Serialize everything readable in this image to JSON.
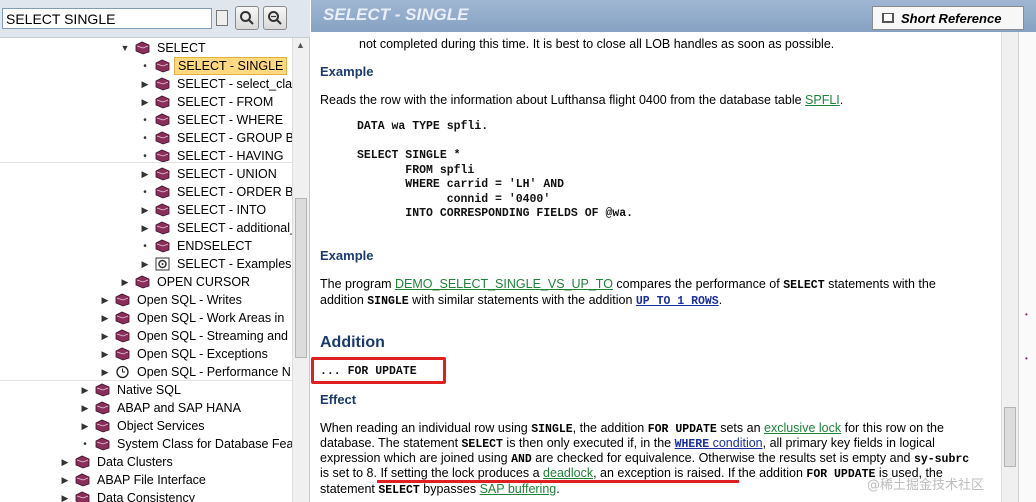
{
  "search": {
    "value": "SELECT SINGLE"
  },
  "tree": [
    {
      "label": "SELECT",
      "level": 2,
      "marker": "arrow-down",
      "icon": "book-icon"
    },
    {
      "label": "SELECT - SINGLE",
      "level": 3,
      "marker": "bullet",
      "icon": "book-icon",
      "selected": true
    },
    {
      "label": "SELECT - select_clau",
      "level": 3,
      "marker": "arrow-right",
      "icon": "book-icon"
    },
    {
      "label": "SELECT - FROM",
      "level": 3,
      "marker": "arrow-right",
      "icon": "book-icon"
    },
    {
      "label": "SELECT - WHERE",
      "level": 3,
      "marker": "bullet",
      "icon": "book-icon"
    },
    {
      "label": "SELECT - GROUP BY",
      "level": 3,
      "marker": "bullet",
      "icon": "book-icon"
    },
    {
      "label": "SELECT - HAVING",
      "level": 3,
      "marker": "bullet",
      "icon": "book-icon"
    },
    {
      "label": "SELECT - UNION",
      "level": 3,
      "marker": "arrow-right",
      "icon": "book-icon"
    },
    {
      "label": "SELECT - ORDER BY",
      "level": 3,
      "marker": "bullet",
      "icon": "book-icon"
    },
    {
      "label": "SELECT - INTO",
      "level": 3,
      "marker": "arrow-right",
      "icon": "book-icon"
    },
    {
      "label": "SELECT - additional_",
      "level": 3,
      "marker": "arrow-right",
      "icon": "book-icon"
    },
    {
      "label": "ENDSELECT",
      "level": 3,
      "marker": "bullet",
      "icon": "book-icon"
    },
    {
      "label": "SELECT - Examples",
      "level": 3,
      "marker": "arrow-right",
      "icon": "gear-icon"
    },
    {
      "label": "OPEN CURSOR",
      "level": 2,
      "marker": "arrow-right",
      "icon": "book-icon"
    },
    {
      "label": "Open SQL - Writes",
      "level": 1,
      "marker": "arrow-right",
      "icon": "book-icon"
    },
    {
      "label": "Open SQL - Work Areas in",
      "level": 1,
      "marker": "arrow-right",
      "icon": "book-icon"
    },
    {
      "label": "Open SQL - Streaming and",
      "level": 1,
      "marker": "arrow-right",
      "icon": "book-icon"
    },
    {
      "label": "Open SQL - Exceptions",
      "level": 1,
      "marker": "arrow-right",
      "icon": "book-icon"
    },
    {
      "label": "Open SQL - Performance N",
      "level": 1,
      "marker": "arrow-right",
      "icon": "clock-icon"
    },
    {
      "label": "Native SQL",
      "level": 0,
      "marker": "arrow-right",
      "icon": "book-icon"
    },
    {
      "label": "ABAP and SAP HANA",
      "level": 0,
      "marker": "arrow-right",
      "icon": "book-icon"
    },
    {
      "label": "Object Services",
      "level": 0,
      "marker": "arrow-right",
      "icon": "book-icon"
    },
    {
      "label": "System Class for Database Feat",
      "level": 0,
      "marker": "bullet",
      "icon": "book-icon"
    },
    {
      "label": "Data Clusters",
      "level": -1,
      "marker": "arrow-right",
      "icon": "book-icon"
    },
    {
      "label": "ABAP File Interface",
      "level": -1,
      "marker": "arrow-right",
      "icon": "book-icon"
    },
    {
      "label": "Data Consistency",
      "level": -1,
      "marker": "arrow-right",
      "icon": "book-icon"
    }
  ],
  "header": {
    "title": "SELECT - SINGLE",
    "short_reference": "Short Reference"
  },
  "doc": {
    "intro_tail": "not completed during this time. It is best to close all LOB handles as soon as possible.",
    "example1_heading": "Example",
    "example1_text_a": "Reads the row with the information about Lufthansa flight 0400 from the database table ",
    "example1_link": "SPFLI",
    "example1_text_b": ".",
    "code1": "DATA wa TYPE spfli.",
    "code2": "SELECT SINGLE *\n       FROM spfli\n       WHERE carrid = 'LH' AND\n             connid = '0400'\n       INTO CORRESPONDING FIELDS OF @wa.",
    "example2_heading": "Example",
    "example2_a": "The program ",
    "example2_link": "DEMO_SELECT_SINGLE_VS_UP_TO",
    "example2_b": " compares the performance of ",
    "example2_kw1": "SELECT",
    "example2_c": " statements with the",
    "example2_d": "addition ",
    "example2_kw2": "SINGLE",
    "example2_e": " with similar statements with the addition ",
    "example2_link2": "UP TO 1 ROWS",
    "example2_f": ".",
    "addition_heading": "Addition",
    "addition_code": "... FOR UPDATE",
    "effect_heading": "Effect",
    "effect_l1a": "When reading an individual row using ",
    "effect_l1kw": "SINGLE",
    "effect_l1b": ", the addition ",
    "effect_l1kw2": "FOR UPDATE",
    "effect_l1c": " sets an ",
    "effect_l1link": "exclusive lock",
    "effect_l1d": " for this row on the",
    "effect_l2a": "database. The statement ",
    "effect_l2kw": "SELECT",
    "effect_l2b": " is then only executed if, in the ",
    "effect_l2link": "WHERE",
    "effect_l2link2": " condition",
    "effect_l2c": ", all primary key fields in logical",
    "effect_l3a": "expression which are joined using ",
    "effect_l3kw": "AND",
    "effect_l3b": " are checked for equivalence. Otherwise the results set is empty and ",
    "effect_l3kw2": "sy-subrc",
    "effect_l4a": "is set to 8. If setting the lock produces a ",
    "effect_l4link": "deadlock",
    "effect_l4b": ", an exception is raised. If the addition ",
    "effect_l4kw": "FOR UPDATE",
    "effect_l4c": " is used, the",
    "effect_l5a": "statement ",
    "effect_l5kw": "SELECT",
    "effect_l5b": " bypasses ",
    "effect_l5link": "SAP buffering",
    "effect_l5c": "."
  },
  "watermark": "@稀土掘金技术社区",
  "colors": {
    "highlight": "#ffd980",
    "header": "#9fb7d3",
    "annotation": "#e02020",
    "link": "#20813b"
  }
}
